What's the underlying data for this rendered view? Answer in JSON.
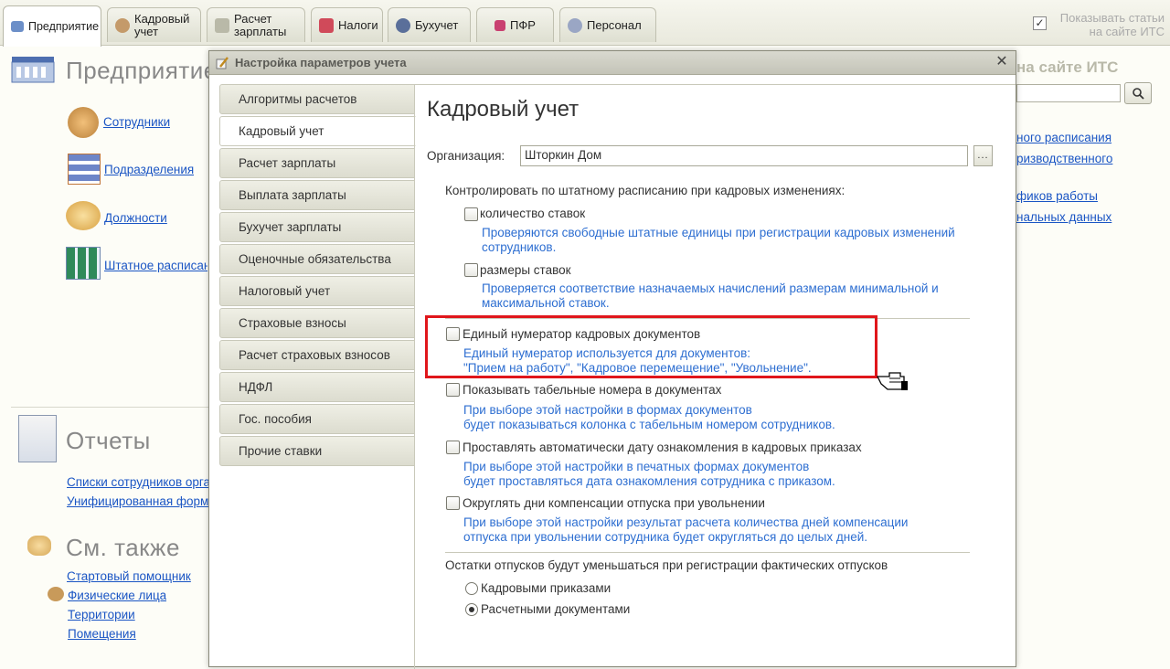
{
  "top_tabs": [
    {
      "label": "Предприятие",
      "active": true
    },
    {
      "label": "Кадровый учет"
    },
    {
      "label": "Расчет зарплаты"
    },
    {
      "label": "Налоги"
    },
    {
      "label": "Бухучет"
    },
    {
      "label": "ПФР"
    },
    {
      "label": "Персонал"
    }
  ],
  "itc": {
    "show_articles_label": "Показывать статьи на сайте ИТС",
    "right_panel_title": "на сайте ИТС",
    "links": [
      "ного расписания",
      "ризводственного",
      "фиков работы",
      "нальных данных"
    ]
  },
  "enterprise": {
    "title": "Предприятие",
    "links": [
      "Сотрудники",
      "Подразделения",
      "Должности",
      "Штатное расписание"
    ]
  },
  "reports": {
    "title": "Отчеты",
    "links": [
      "Списки сотрудников организации",
      "Унифицированная форма"
    ]
  },
  "see_also": {
    "title": "См. также",
    "links": [
      "Стартовый помощник",
      "Физические лица",
      "Территории",
      "Помещения"
    ]
  },
  "dialog": {
    "title": "Настройка параметров учета",
    "close": "✕",
    "nav": [
      "Алгоритмы расчетов",
      "Кадровый учет",
      "Расчет зарплаты",
      "Выплата зарплаты",
      "Бухучет зарплаты",
      "Оценочные обязательства",
      "Налоговый учет",
      "Страховые взносы",
      "Расчет страховых взносов",
      "НДФЛ",
      "Гос. пособия",
      "Прочие ставки"
    ],
    "active_nav": "Кадровый учет",
    "heading": "Кадровый учет",
    "org_label": "Организация:",
    "org_value": "Шторкин Дом",
    "org_btn": "...",
    "control_label": "Контролировать по штатному расписанию при кадровых изменениях:",
    "option_rates_count": {
      "label": "количество ставок",
      "checked": false,
      "hint1": "Проверяются свободные штатные единицы при регистрации кадровых изменений",
      "hint2": "сотрудников."
    },
    "option_rates_size": {
      "label": "размеры ставок",
      "checked": false,
      "hint1": "Проверяется соответствие назначаемых начислений размерам минимальной и",
      "hint2": "максимальной ставок."
    },
    "option_single_numerator": {
      "label": "Единый нумератор кадровых документов",
      "checked": false,
      "hint1": "Единый нумератор используется для документов:",
      "hint2": "\"Прием на работу\", \"Кадровое перемещение\", \"Увольнение\"."
    },
    "option_show_tab_numbers": {
      "label": "Показывать табельные номера в документах",
      "checked": false,
      "hint1": "При выборе этой настройки в формах документов",
      "hint2": "будет показываться колонка с табельным номером сотрудников."
    },
    "option_auto_date": {
      "label": "Проставлять автоматически дату ознакомления в кадровых приказах",
      "checked": false,
      "hint1": "При выборе этой настройки в печатных формах документов",
      "hint2": "будет проставляться дата ознакомления сотрудника с приказом."
    },
    "option_round_days": {
      "label": "Округлять дни компенсации отпуска при увольнении",
      "checked": false,
      "hint1": "При выборе этой настройки результат расчета количества дней компенсации",
      "hint2": "отпуска при увольнении сотрудника будет округляться до целых дней."
    },
    "vacation_label": "Остатки отпусков будут уменьшаться при регистрации фактических отпусков",
    "vacation_options": [
      {
        "label": "Кадровыми приказами",
        "selected": false
      },
      {
        "label": "Расчетными документами",
        "selected": true
      }
    ]
  },
  "colors": {
    "link": "#1a55c4",
    "hint": "#2d6ed1",
    "highlight": "#e0161b"
  }
}
